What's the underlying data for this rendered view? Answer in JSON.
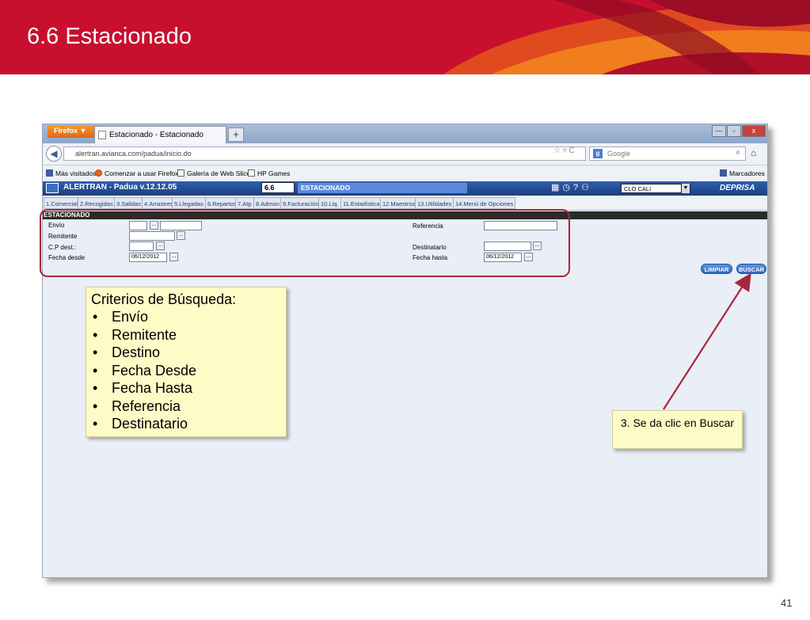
{
  "slide": {
    "title": "6.6 Estacionado",
    "page_number": "41"
  },
  "browser": {
    "firefox_button": "Firefox ▼",
    "tab_title": "Estacionado - Estacionado",
    "new_tab": "+",
    "url": "alertran.avianca.com/padua/inicio.do",
    "search_placeholder": "Google",
    "bookmarks": [
      "Más visitados",
      "Comenzar a usar Firefox",
      "Galería de Web Slice",
      "HP Games"
    ],
    "bookmarks_menu": "Marcadores"
  },
  "app": {
    "title": "ALERTRAN - Padua  v.12.12.05",
    "screen_code": "6.6",
    "screen_name": "ESTACIONADO",
    "location_select": "CLO CALI",
    "brand": "DEPRISA",
    "menu": [
      "1.Comercial",
      "2.Recogidas",
      "3.Salidas",
      "4.Arrastres",
      "5.Llegadas",
      "6.Repartos",
      "7.Atp",
      "8.Admon",
      "9.Facturación",
      "10.Liq.",
      "11.Estadística",
      "12.Maestros",
      "13.Utilidades",
      "14.Menú de Opciones"
    ],
    "section_title": "ESTACIONADO",
    "form": {
      "envio_label": "Envío",
      "remitente_label": "Remitente",
      "cp_dest_label": "C.P dest.:",
      "fecha_desde_label": "Fecha desde",
      "fecha_desde_value": "06/12/2012",
      "referencia_label": "Referencia",
      "destinatario_label": "Destinatario",
      "fecha_hasta_label": "Fecha hasta",
      "fecha_hasta_value": "06/12/2012",
      "lookup_button": "..."
    },
    "buttons": {
      "limpiar": "LIMPIAR",
      "buscar": "BUSCAR"
    }
  },
  "callouts": {
    "criteria_title": "Criterios de Búsqueda:",
    "criteria_items": [
      "Envío",
      "Remitente",
      "Destino",
      "Fecha Desde",
      "Fecha Hasta",
      "Referencia",
      "Destinatario"
    ],
    "step": "3. Se da clic en Buscar"
  },
  "colors": {
    "banner": "#c8102e",
    "highlight": "#a8263a",
    "callout_bg": "#fffbc7",
    "app_bar": "#1d3f7d"
  }
}
